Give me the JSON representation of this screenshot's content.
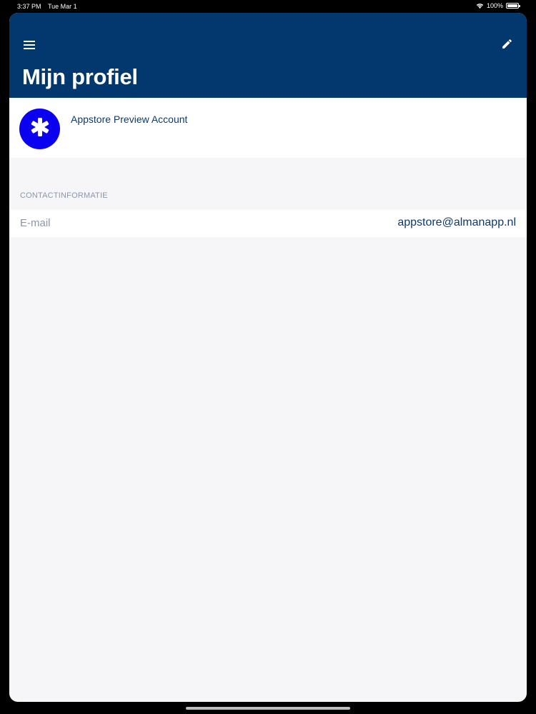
{
  "status_bar": {
    "time": "3:37 PM",
    "date": "Tue Mar 1",
    "battery": "100%",
    "icons": {
      "wifi": "wifi-icon",
      "battery": "battery-icon"
    }
  },
  "header": {
    "title": "Mijn profiel",
    "background_color": "#02386e",
    "icons": {
      "menu": "menu-icon",
      "edit": "pencil-icon"
    }
  },
  "profile": {
    "name": "Appstore Preview Account",
    "avatar_color": "#0a00f2",
    "avatar_icon": "asterisk-icon"
  },
  "contact": {
    "section_title": "CONTACTINFORMATIE",
    "rows": [
      {
        "label": "E-mail",
        "value": "appstore@almanapp.nl"
      }
    ]
  }
}
